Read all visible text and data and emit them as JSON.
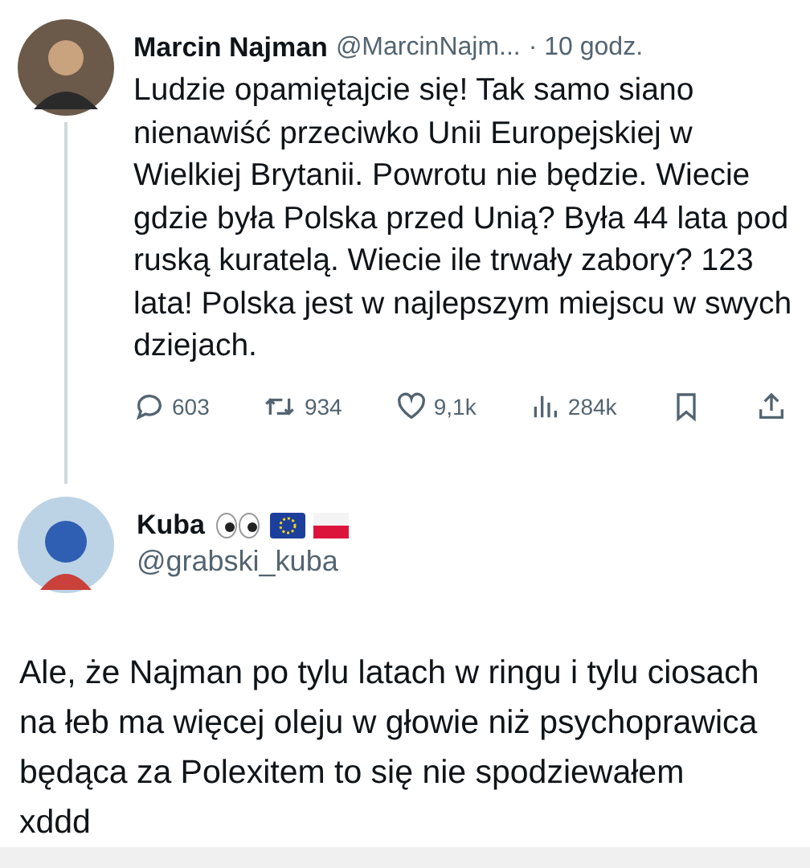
{
  "tweet": {
    "author": "Marcin Najman",
    "handle": "@MarcinNajm...",
    "time": "· 10 godz.",
    "text": "Ludzie opamiętajcie się! Tak samo siano nienawiść przeciwko Unii Europejskiej w Wielkiej Brytanii. Powrotu nie będzie. Wiecie gdzie była Polska przed Unią? Była 44 lata pod ruską kuratelą. Wiecie ile trwały zabory? 123 lata! Polska jest w najlepszym miejscu w swych dziejach.",
    "actions": [
      {
        "kind": "reply",
        "count": "603"
      },
      {
        "kind": "retweet",
        "count": "934"
      },
      {
        "kind": "like",
        "count": "9,1k"
      },
      {
        "kind": "views",
        "count": "284k"
      },
      {
        "kind": "bookmark"
      },
      {
        "kind": "share"
      }
    ]
  },
  "reply": {
    "author": "Kuba",
    "handle": "@grabski_kuba",
    "text": "Ale, że Najman po tylu latach w ringu i tylu ciosach na łeb ma więcej oleju w głowie niż psychoprawica będąca za Polexitem to się nie spodziewałem xddd"
  }
}
